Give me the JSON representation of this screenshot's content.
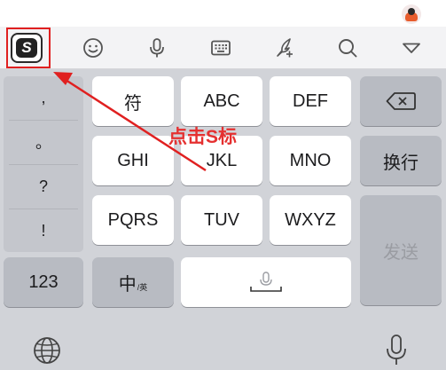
{
  "annotation": {
    "text": "点击S标"
  },
  "toolbar": {
    "icons": [
      "sogou-logo-icon",
      "emoji-icon",
      "microphone-icon",
      "keyboard-icon",
      "quill-pen-icon",
      "search-icon",
      "collapse-triangle-icon"
    ],
    "logo_letter": "S"
  },
  "punctuation": [
    ",",
    "。",
    "?",
    "!"
  ],
  "keys": {
    "row1": [
      "符",
      "ABC",
      "DEF"
    ],
    "row2": [
      "GHI",
      "JKL",
      "MNO"
    ],
    "row3": [
      "PQRS",
      "TUV",
      "WXYZ"
    ],
    "newline": "换行",
    "send": "发送",
    "num": "123",
    "lang_main": "中",
    "lang_sub": "/英"
  },
  "colors": {
    "annotation_red": "#e02020",
    "keyboard_bg": "#d1d3d8"
  }
}
